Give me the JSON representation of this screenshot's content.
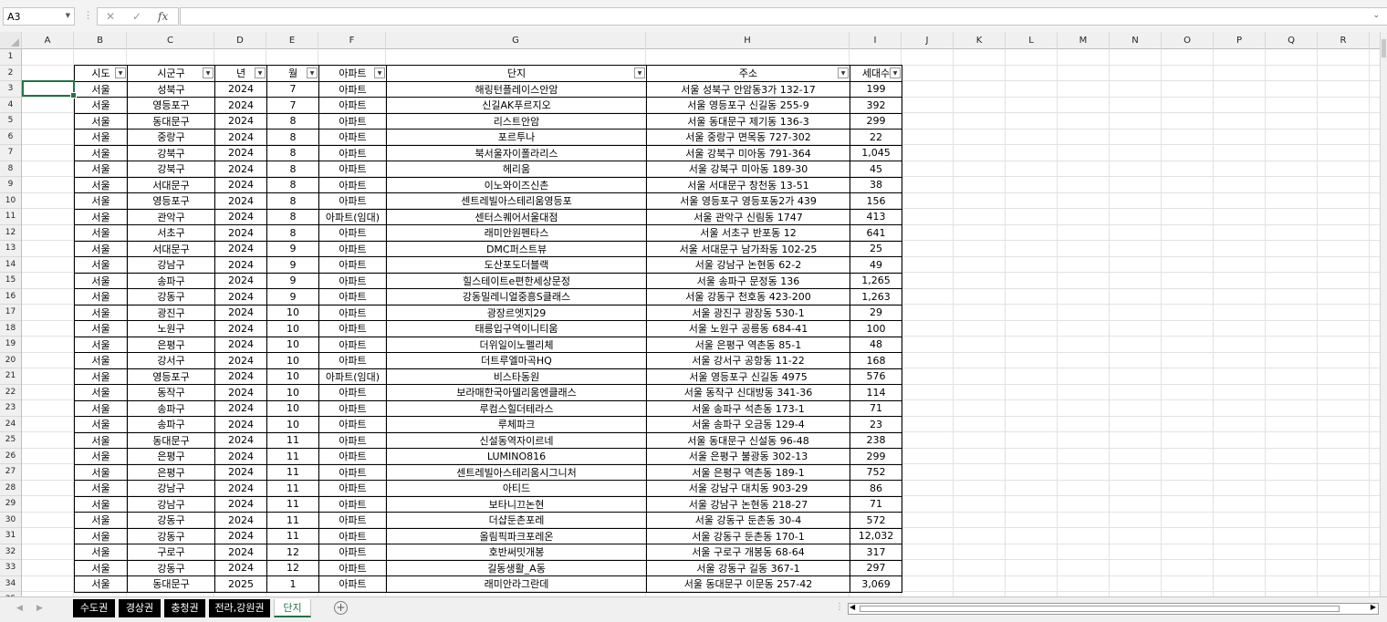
{
  "formula_bar": {
    "name_box": "A3",
    "formula": "",
    "cancel_glyph": "✕",
    "enter_glyph": "✓",
    "fx_label": "fx"
  },
  "columns": [
    {
      "label": "A",
      "w": 57
    },
    {
      "label": "B",
      "w": 58
    },
    {
      "label": "C",
      "w": 96
    },
    {
      "label": "D",
      "w": 57
    },
    {
      "label": "E",
      "w": 57
    },
    {
      "label": "F",
      "w": 74
    },
    {
      "label": "G",
      "w": 285
    },
    {
      "label": "H",
      "w": 223
    },
    {
      "label": "I",
      "w": 57
    },
    {
      "label": "J",
      "w": 57
    },
    {
      "label": "K",
      "w": 57
    },
    {
      "label": "L",
      "w": 57
    },
    {
      "label": "M",
      "w": 57
    },
    {
      "label": "N",
      "w": 57
    },
    {
      "label": "O",
      "w": 57
    },
    {
      "label": "P",
      "w": 57
    },
    {
      "label": "Q",
      "w": 57
    },
    {
      "label": "R",
      "w": 57
    }
  ],
  "table": {
    "headers": [
      "시도",
      "시군구",
      "년",
      "월",
      "아파트",
      "단지",
      "주소",
      "세대수"
    ],
    "rows": [
      [
        "서울",
        "성북구",
        "2024",
        "7",
        "아파트",
        "해링턴플레이스안암",
        "서울 성북구 안암동3가 132-17",
        "199"
      ],
      [
        "서울",
        "영등포구",
        "2024",
        "7",
        "아파트",
        "신길AK푸르지오",
        "서울 영등포구 신길동 255-9",
        "392"
      ],
      [
        "서울",
        "동대문구",
        "2024",
        "8",
        "아파트",
        "리스트안암",
        "서울 동대문구 제기동 136-3",
        "299"
      ],
      [
        "서울",
        "중랑구",
        "2024",
        "8",
        "아파트",
        "포르투나",
        "서울 중랑구 면목동 727-302",
        "22"
      ],
      [
        "서울",
        "강북구",
        "2024",
        "8",
        "아파트",
        "북서울자이폴라리스",
        "서울 강북구 미아동 791-364",
        "1,045"
      ],
      [
        "서울",
        "강북구",
        "2024",
        "8",
        "아파트",
        "헤리움",
        "서울 강북구 미아동 189-30",
        "45"
      ],
      [
        "서울",
        "서대문구",
        "2024",
        "8",
        "아파트",
        "이노와이즈신촌",
        "서울 서대문구 창천동 13-51",
        "38"
      ],
      [
        "서울",
        "영등포구",
        "2024",
        "8",
        "아파트",
        "센트레빌아스테리움영등포",
        "서울 영등포구 영등포동2가 439",
        "156"
      ],
      [
        "서울",
        "관악구",
        "2024",
        "8",
        "아파트(임대)",
        "센터스퀘어서울대점",
        "서울 관악구 신림동 1747",
        "413"
      ],
      [
        "서울",
        "서초구",
        "2024",
        "8",
        "아파트",
        "래미안원펜타스",
        "서울 서초구 반포동 12",
        "641"
      ],
      [
        "서울",
        "서대문구",
        "2024",
        "9",
        "아파트",
        "DMC퍼스트뷰",
        "서울 서대문구 남가좌동 102-25",
        "25"
      ],
      [
        "서울",
        "강남구",
        "2024",
        "9",
        "아파트",
        "도산포도더블랙",
        "서울 강남구 논현동 62-2",
        "49"
      ],
      [
        "서울",
        "송파구",
        "2024",
        "9",
        "아파트",
        "힐스테이트e편한세상문정",
        "서울 송파구 문정동 136",
        "1,265"
      ],
      [
        "서울",
        "강동구",
        "2024",
        "9",
        "아파트",
        "강동밀레니얼중흥S클래스",
        "서울 강동구 천호동 423-200",
        "1,263"
      ],
      [
        "서울",
        "광진구",
        "2024",
        "10",
        "아파트",
        "광장르엣지29",
        "서울 광진구 광장동 530-1",
        "29"
      ],
      [
        "서울",
        "노원구",
        "2024",
        "10",
        "아파트",
        "태릉입구역이니티움",
        "서울 노원구 공릉동 684-41",
        "100"
      ],
      [
        "서울",
        "은평구",
        "2024",
        "10",
        "아파트",
        "더위일이노펠리체",
        "서울 은평구 역촌동 85-1",
        "48"
      ],
      [
        "서울",
        "강서구",
        "2024",
        "10",
        "아파트",
        "더트루엘마곡HQ",
        "서울 강서구 공항동 11-22",
        "168"
      ],
      [
        "서울",
        "영등포구",
        "2024",
        "10",
        "아파트(임대)",
        "비스타동원",
        "서울 영등포구 신길동 4975",
        "576"
      ],
      [
        "서울",
        "동작구",
        "2024",
        "10",
        "아파트",
        "보라매한국아델리움엔클래스",
        "서울 동작구 신대방동 341-36",
        "114"
      ],
      [
        "서울",
        "송파구",
        "2024",
        "10",
        "아파트",
        "루컴스힐더테라스",
        "서울 송파구 석촌동 173-1",
        "71"
      ],
      [
        "서울",
        "송파구",
        "2024",
        "10",
        "아파트",
        "루체파크",
        "서울 송파구 오금동 129-4",
        "23"
      ],
      [
        "서울",
        "동대문구",
        "2024",
        "11",
        "아파트",
        "신설동역자이르네",
        "서울 동대문구 신설동 96-48",
        "238"
      ],
      [
        "서울",
        "은평구",
        "2024",
        "11",
        "아파트",
        "LUMINO816",
        "서울 은평구 불광동 302-13",
        "299"
      ],
      [
        "서울",
        "은평구",
        "2024",
        "11",
        "아파트",
        "센트레빌아스테리움시그니처",
        "서울 은평구 역촌동 189-1",
        "752"
      ],
      [
        "서울",
        "강남구",
        "2024",
        "11",
        "아파트",
        "아티드",
        "서울 강남구 대치동 903-29",
        "86"
      ],
      [
        "서울",
        "강남구",
        "2024",
        "11",
        "아파트",
        "보타니끄논현",
        "서울 강남구 논현동 218-27",
        "71"
      ],
      [
        "서울",
        "강동구",
        "2024",
        "11",
        "아파트",
        "더샵둔촌포레",
        "서울 강동구 둔촌동 30-4",
        "572"
      ],
      [
        "서울",
        "강동구",
        "2024",
        "11",
        "아파트",
        "올림픽파크포레온",
        "서울 강동구 둔촌동 170-1",
        "12,032"
      ],
      [
        "서울",
        "구로구",
        "2024",
        "12",
        "아파트",
        "호반써밋개봉",
        "서울 구로구 개봉동 68-64",
        "317"
      ],
      [
        "서울",
        "강동구",
        "2024",
        "12",
        "아파트",
        "길동생활_A동",
        "서울 강동구 길동 367-1",
        "297"
      ],
      [
        "서울",
        "동대문구",
        "2025",
        "1",
        "아파트",
        "래미안라그란데",
        "서울 동대문구 이문동 257-42",
        "3,069"
      ]
    ]
  },
  "sheet_tabs": [
    {
      "label": "수도권",
      "active": false
    },
    {
      "label": "경상권",
      "active": false
    },
    {
      "label": "충청권",
      "active": false
    },
    {
      "label": "전라,강원권",
      "active": false
    },
    {
      "label": "단지",
      "active": true
    }
  ],
  "add_sheet_glyph": "+",
  "nav_prev": "◀",
  "nav_next": "▶"
}
